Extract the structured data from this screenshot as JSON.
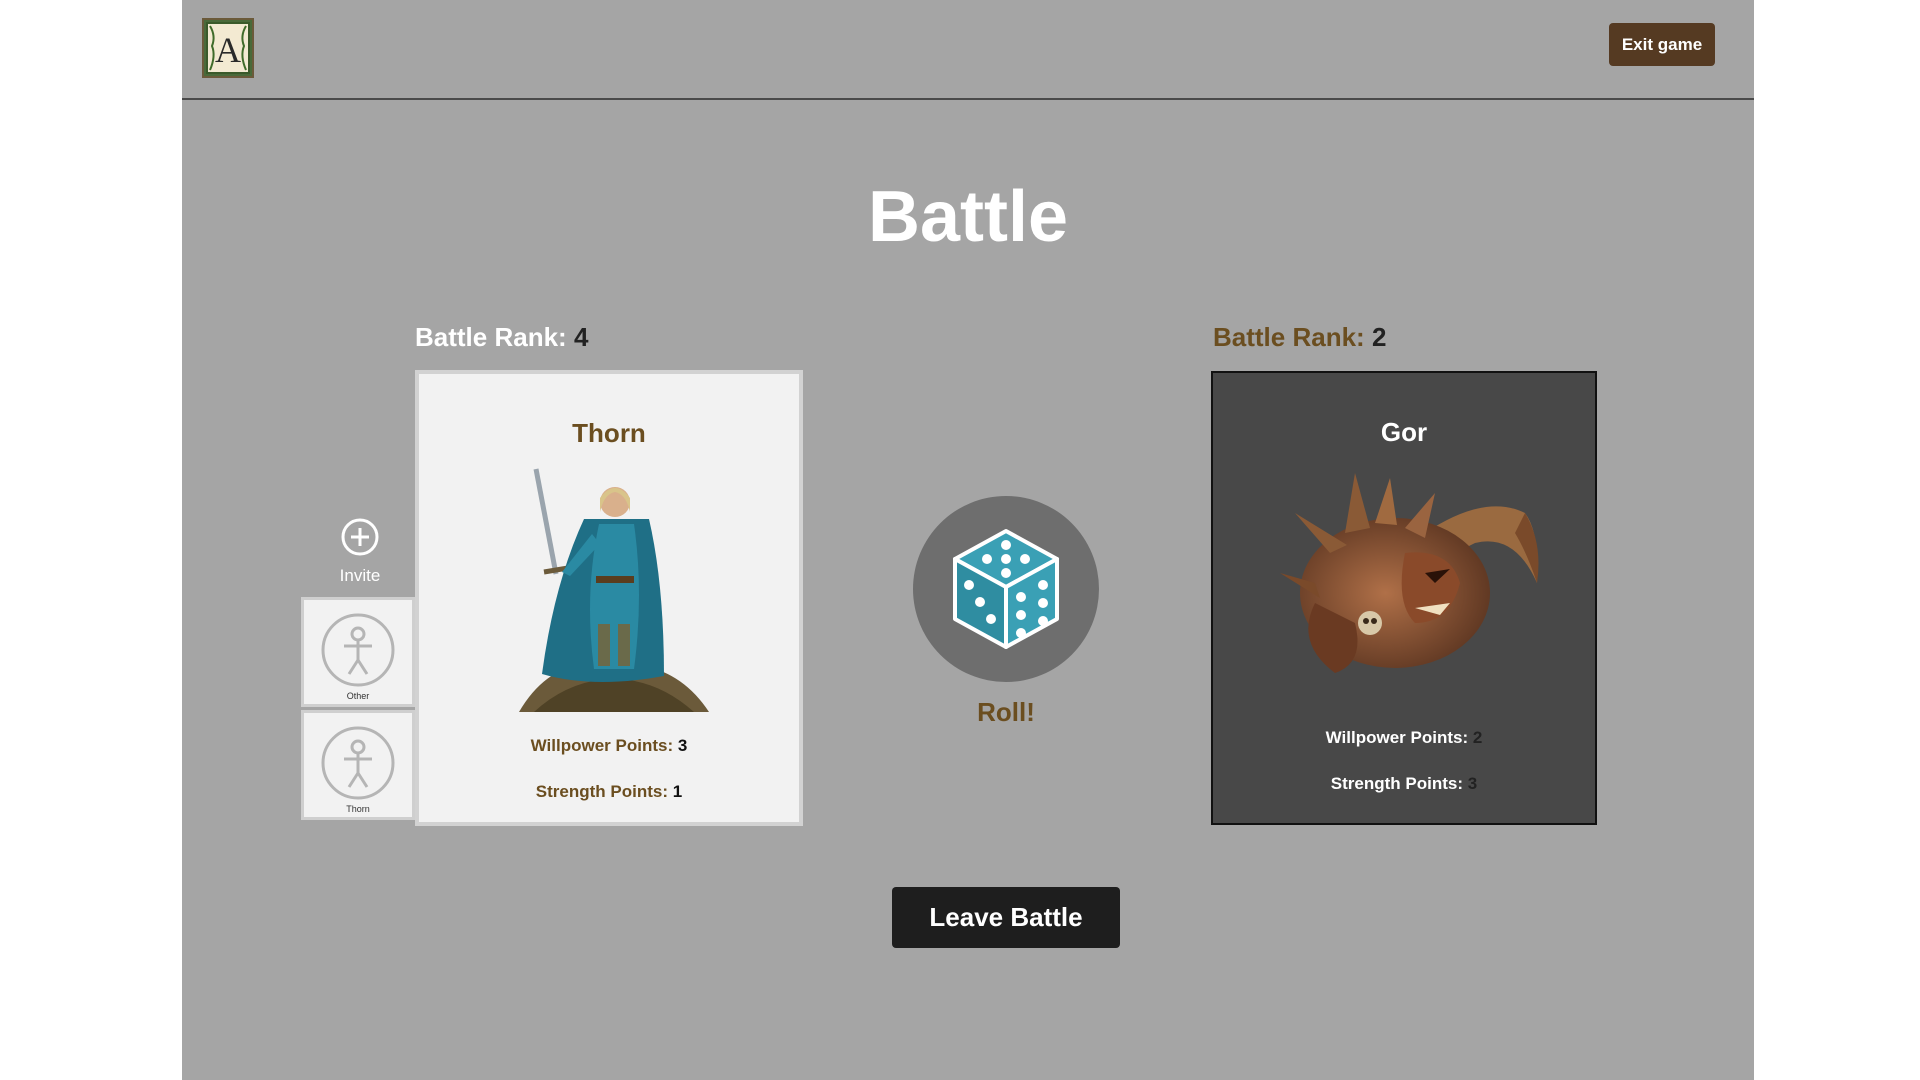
{
  "header": {
    "logo_letter": "A",
    "exit_label": "Exit game"
  },
  "page": {
    "title": "Battle"
  },
  "hero": {
    "rank_label": "Battle Rank:",
    "rank_value": "4",
    "name": "Thorn",
    "willpower_label": "Willpower Points:",
    "willpower_value": "3",
    "strength_label": "Strength Points:",
    "strength_value": "1"
  },
  "party": {
    "invite_label": "Invite",
    "members": [
      {
        "name": "Other",
        "icon": "person-icon"
      },
      {
        "name": "Thorn",
        "icon": "person-icon"
      }
    ]
  },
  "enemy": {
    "rank_label": "Battle Rank:",
    "rank_value": "2",
    "name": "Gor",
    "willpower_label": "Willpower Points:",
    "willpower_value": "2",
    "strength_label": "Strength Points:",
    "strength_value": "3"
  },
  "dice": {
    "roll_label": "Roll!",
    "icon": "dice-icon"
  },
  "actions": {
    "leave_label": "Leave Battle"
  },
  "colors": {
    "background": "#a5a5a5",
    "accent_brown": "#6b4e20",
    "exit_button": "#553a22",
    "dice_teal": "#3aa0b5",
    "enemy_card": "#484848"
  }
}
